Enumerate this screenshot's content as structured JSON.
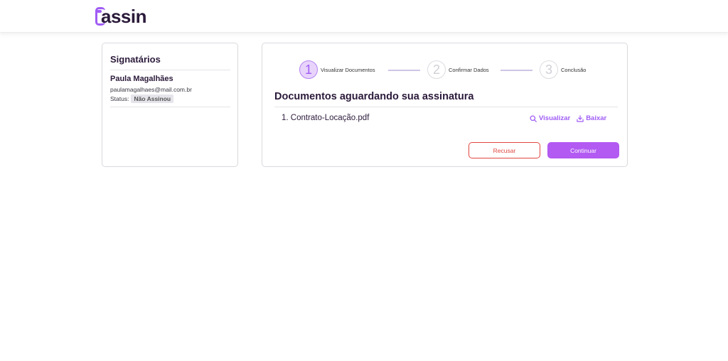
{
  "header": {
    "logo_text": "assin",
    "brand_color": "#a05cf5"
  },
  "signatories": {
    "title": "Signatários",
    "signer": {
      "name": "Paula Magalhães",
      "email": "paulamagalhaes@mail.com.br",
      "status_label": "Status:",
      "status_value": "Não Assinou"
    }
  },
  "stepper": {
    "steps": [
      {
        "number": "1",
        "label": "Visualizar Documentos",
        "active": true
      },
      {
        "number": "2",
        "label": "Confirmar Dados",
        "active": false
      },
      {
        "number": "3",
        "label": "Conclusão",
        "active": false
      }
    ]
  },
  "documents": {
    "title": "Documentos aguardando sua assinatura",
    "items": [
      {
        "name": "1. Contrato-Locação.pdf",
        "view_label": "Visualizar",
        "download_label": "Baixar"
      }
    ]
  },
  "actions": {
    "refuse_label": "Recusar",
    "continue_label": "Continuar",
    "refuse_color": "#e0463f",
    "continue_color": "#b25af2"
  }
}
